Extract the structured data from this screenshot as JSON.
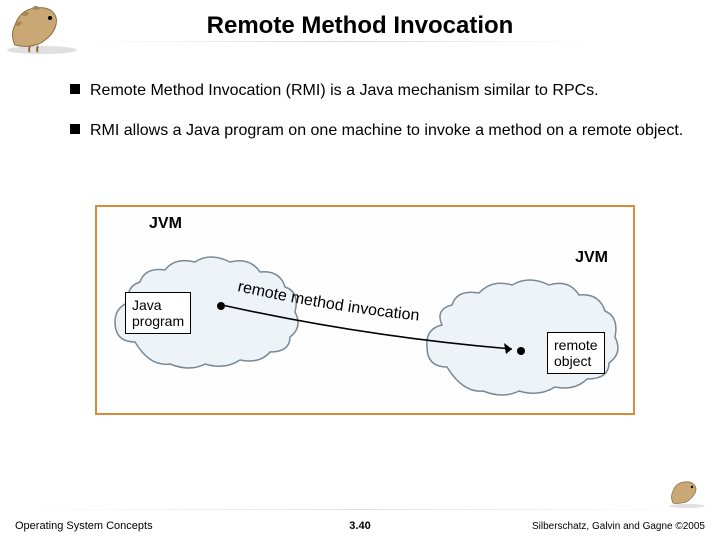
{
  "title": "Remote Method Invocation",
  "bullets": [
    "Remote Method Invocation (RMI) is a Java mechanism similar to RPCs.",
    "RMI allows a Java program on one machine to invoke a method on a remote object."
  ],
  "diagram": {
    "jvm_left": "JVM",
    "jvm_right": "JVM",
    "java_program": "Java\nprogram",
    "remote_object": "remote\nobject",
    "rmi_label": "remote method invocation"
  },
  "footer": {
    "left": "Operating System Concepts",
    "center": "3.40",
    "right": "Silberschatz, Galvin and Gagne ©2005"
  }
}
